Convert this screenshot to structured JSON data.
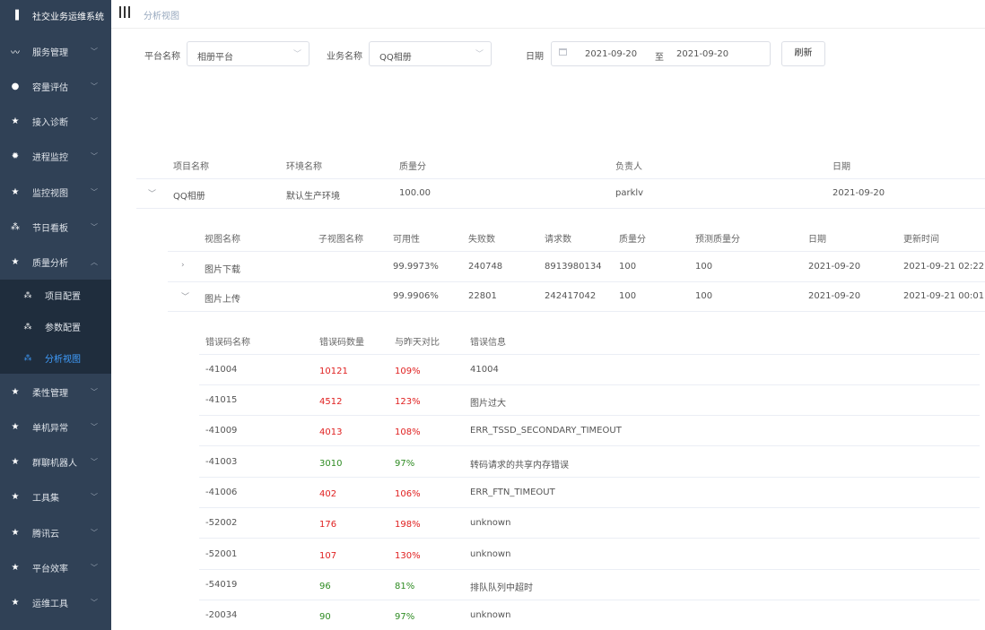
{
  "sidebar": {
    "title": "社交业务运维系统",
    "items": [
      {
        "label": "服务管理",
        "icon": "wave-icon"
      },
      {
        "label": "容量评估",
        "icon": "bell-icon"
      },
      {
        "label": "接入诊断",
        "icon": "star-icon"
      },
      {
        "label": "进程监控",
        "icon": "bug-icon"
      },
      {
        "label": "监控视图",
        "icon": "star-icon"
      },
      {
        "label": "节日看板",
        "icon": "tree-icon"
      },
      {
        "label": "质量分析",
        "icon": "star-icon"
      }
    ],
    "sub_items": [
      {
        "label": "项目配置",
        "icon": "tree-icon"
      },
      {
        "label": "参数配置",
        "icon": "tree-icon"
      },
      {
        "label": "分析视图",
        "icon": "tree-icon"
      }
    ],
    "items_after": [
      {
        "label": "柔性管理",
        "icon": "star-icon"
      },
      {
        "label": "单机异常",
        "icon": "star-icon"
      },
      {
        "label": "群聊机器人",
        "icon": "star-icon"
      },
      {
        "label": "工具集",
        "icon": "star-icon"
      },
      {
        "label": "腾讯云",
        "icon": "star-icon"
      },
      {
        "label": "平台效率",
        "icon": "star-icon"
      },
      {
        "label": "运维工具",
        "icon": "star-icon"
      }
    ]
  },
  "breadcrumb": "分析视图",
  "filters": {
    "platform_label": "平台名称",
    "platform_value": "相册平台",
    "service_label": "业务名称",
    "service_value": "QQ相册",
    "date_label": "日期",
    "date_start": "2021-09-20",
    "date_sep": "至",
    "date_end": "2021-09-20",
    "refresh": "刷新"
  },
  "project_table": {
    "headers": [
      "项目名称",
      "环境名称",
      "质量分",
      "负责人",
      "日期"
    ],
    "row": [
      "QQ相册",
      "默认生产环境",
      "100.00",
      "parklv",
      "2021-09-20"
    ]
  },
  "view_table": {
    "headers": [
      "视图名称",
      "子视图名称",
      "可用性",
      "失败数",
      "请求数",
      "质量分",
      "预测质量分",
      "日期",
      "更新时间"
    ],
    "rows": [
      {
        "name": "图片下载",
        "sub": "",
        "avail": "99.9973%",
        "fail": "240748",
        "req": "8913980134",
        "score": "100",
        "pred": "100",
        "date": "2021-09-20",
        "updated": "2021-09-21 02:22"
      },
      {
        "name": "图片上传",
        "sub": "",
        "avail": "99.9906%",
        "fail": "22801",
        "req": "242417042",
        "score": "100",
        "pred": "100",
        "date": "2021-09-20",
        "updated": "2021-09-21 00:01"
      }
    ]
  },
  "error_table": {
    "headers": [
      "错误码名称",
      "错误码数量",
      "与昨天对比",
      "错误信息"
    ],
    "rows": [
      {
        "code": "-41004",
        "count": "10121",
        "cmp": "109%",
        "msg": "41004",
        "trend": "up"
      },
      {
        "code": "-41015",
        "count": "4512",
        "cmp": "123%",
        "msg": "图片过大",
        "trend": "up"
      },
      {
        "code": "-41009",
        "count": "4013",
        "cmp": "108%",
        "msg": "ERR_TSSD_SECONDARY_TIMEOUT",
        "trend": "up"
      },
      {
        "code": "-41003",
        "count": "3010",
        "cmp": "97%",
        "msg": "转码请求的共享内存错误",
        "trend": "down"
      },
      {
        "code": "-41006",
        "count": "402",
        "cmp": "106%",
        "msg": "ERR_FTN_TIMEOUT",
        "trend": "up"
      },
      {
        "code": "-52002",
        "count": "176",
        "cmp": "198%",
        "msg": "unknown",
        "trend": "up"
      },
      {
        "code": "-52001",
        "count": "107",
        "cmp": "130%",
        "msg": "unknown",
        "trend": "up"
      },
      {
        "code": "-54019",
        "count": "96",
        "cmp": "81%",
        "msg": "排队队列中超时",
        "trend": "down"
      },
      {
        "code": "-20034",
        "count": "90",
        "cmp": "97%",
        "msg": "unknown",
        "trend": "down"
      }
    ]
  },
  "colors": {
    "sidebar_bg": "#304156",
    "submenu_bg": "#1f2d3d",
    "active": "#409eff",
    "increase": "#e02020",
    "decrease": "#2e8b22"
  }
}
